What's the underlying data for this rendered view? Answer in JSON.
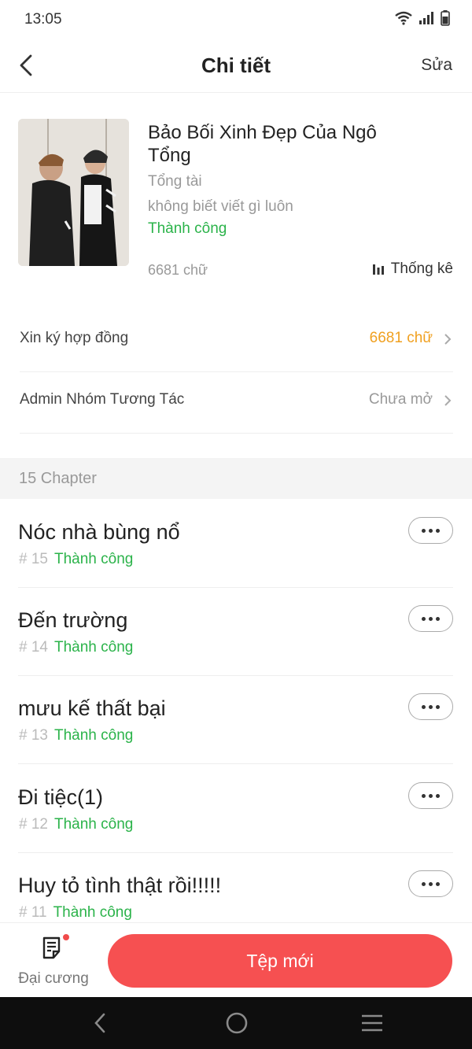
{
  "status_bar": {
    "time": "13:05"
  },
  "nav": {
    "title": "Chi tiết",
    "edit_label": "Sửa"
  },
  "book": {
    "title": "Bảo Bối Xinh Đẹp Của Ngô Tổng",
    "genre": "Tổng tài",
    "description": "không biết viết gì luôn",
    "status": "Thành công",
    "word_count": "6681 chữ",
    "stats_label": "Thống kê"
  },
  "rows": [
    {
      "label": "Xin ký hợp đồng",
      "value": "6681 chữ",
      "value_color": "#f0a020"
    },
    {
      "label": "Admin Nhóm Tương Tác",
      "value": "Chưa mở",
      "value_color": "#999999"
    }
  ],
  "chapters_header": "15 Chapter",
  "chapters": [
    {
      "title": "Nóc nhà bùng nổ",
      "number": "# 15",
      "status": "Thành công"
    },
    {
      "title": "Đến trường",
      "number": "# 14",
      "status": "Thành công"
    },
    {
      "title": "mưu kế thất bại",
      "number": "# 13",
      "status": "Thành công"
    },
    {
      "title": "Đi tiệc(1)",
      "number": "# 12",
      "status": "Thành công"
    },
    {
      "title": "Huy tỏ tình thật rồi!!!!!",
      "number": "# 11",
      "status": "Thành công"
    }
  ],
  "bottom": {
    "outline_label": "Đại cương",
    "new_file_label": "Tệp mới"
  },
  "colors": {
    "accent": "#f65051",
    "success": "#2bb34a",
    "highlight": "#f0a020"
  },
  "icons": [
    "wifi-icon",
    "signal-icon",
    "battery-icon",
    "back-arrow-icon",
    "bar-chart-icon",
    "chevron-right-icon",
    "more-dots-icon",
    "outline-document-icon",
    "nav-back-icon",
    "nav-home-icon",
    "nav-menu-icon"
  ]
}
